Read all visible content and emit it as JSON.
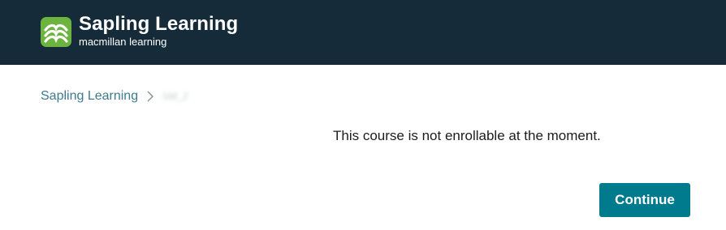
{
  "header": {
    "brand_name": "Sapling Learning",
    "brand_sub": "macmillan learning",
    "logo_icon": "sapling-logo-icon",
    "brand_color": "#6cb33f",
    "background_color": "#152b3a"
  },
  "breadcrumb": {
    "root_label": "Sapling Learning",
    "separator_icon": "chevron-right-icon",
    "current_label": "SM_2"
  },
  "main": {
    "message": "This course is not enrollable at the moment.",
    "continue_label": "Continue",
    "accent_color": "#007b8e"
  }
}
